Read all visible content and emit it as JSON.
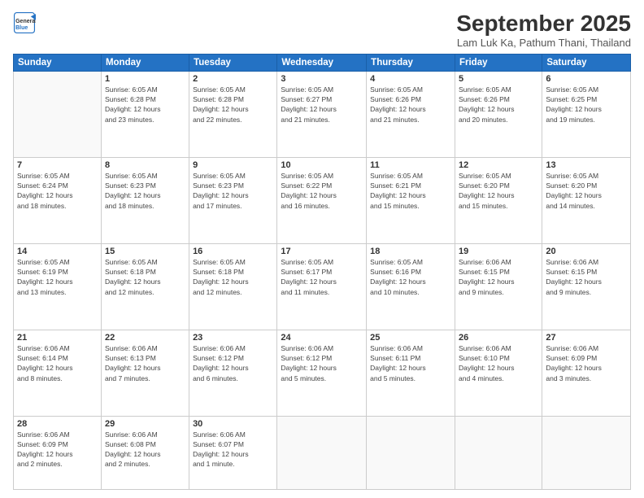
{
  "header": {
    "logo_line1": "General",
    "logo_line2": "Blue",
    "month": "September 2025",
    "location": "Lam Luk Ka, Pathum Thani, Thailand"
  },
  "weekdays": [
    "Sunday",
    "Monday",
    "Tuesday",
    "Wednesday",
    "Thursday",
    "Friday",
    "Saturday"
  ],
  "weeks": [
    [
      {
        "day": "",
        "info": ""
      },
      {
        "day": "1",
        "info": "Sunrise: 6:05 AM\nSunset: 6:28 PM\nDaylight: 12 hours\nand 23 minutes."
      },
      {
        "day": "2",
        "info": "Sunrise: 6:05 AM\nSunset: 6:28 PM\nDaylight: 12 hours\nand 22 minutes."
      },
      {
        "day": "3",
        "info": "Sunrise: 6:05 AM\nSunset: 6:27 PM\nDaylight: 12 hours\nand 21 minutes."
      },
      {
        "day": "4",
        "info": "Sunrise: 6:05 AM\nSunset: 6:26 PM\nDaylight: 12 hours\nand 21 minutes."
      },
      {
        "day": "5",
        "info": "Sunrise: 6:05 AM\nSunset: 6:26 PM\nDaylight: 12 hours\nand 20 minutes."
      },
      {
        "day": "6",
        "info": "Sunrise: 6:05 AM\nSunset: 6:25 PM\nDaylight: 12 hours\nand 19 minutes."
      }
    ],
    [
      {
        "day": "7",
        "info": "Sunrise: 6:05 AM\nSunset: 6:24 PM\nDaylight: 12 hours\nand 18 minutes."
      },
      {
        "day": "8",
        "info": "Sunrise: 6:05 AM\nSunset: 6:23 PM\nDaylight: 12 hours\nand 18 minutes."
      },
      {
        "day": "9",
        "info": "Sunrise: 6:05 AM\nSunset: 6:23 PM\nDaylight: 12 hours\nand 17 minutes."
      },
      {
        "day": "10",
        "info": "Sunrise: 6:05 AM\nSunset: 6:22 PM\nDaylight: 12 hours\nand 16 minutes."
      },
      {
        "day": "11",
        "info": "Sunrise: 6:05 AM\nSunset: 6:21 PM\nDaylight: 12 hours\nand 15 minutes."
      },
      {
        "day": "12",
        "info": "Sunrise: 6:05 AM\nSunset: 6:20 PM\nDaylight: 12 hours\nand 15 minutes."
      },
      {
        "day": "13",
        "info": "Sunrise: 6:05 AM\nSunset: 6:20 PM\nDaylight: 12 hours\nand 14 minutes."
      }
    ],
    [
      {
        "day": "14",
        "info": "Sunrise: 6:05 AM\nSunset: 6:19 PM\nDaylight: 12 hours\nand 13 minutes."
      },
      {
        "day": "15",
        "info": "Sunrise: 6:05 AM\nSunset: 6:18 PM\nDaylight: 12 hours\nand 12 minutes."
      },
      {
        "day": "16",
        "info": "Sunrise: 6:05 AM\nSunset: 6:18 PM\nDaylight: 12 hours\nand 12 minutes."
      },
      {
        "day": "17",
        "info": "Sunrise: 6:05 AM\nSunset: 6:17 PM\nDaylight: 12 hours\nand 11 minutes."
      },
      {
        "day": "18",
        "info": "Sunrise: 6:05 AM\nSunset: 6:16 PM\nDaylight: 12 hours\nand 10 minutes."
      },
      {
        "day": "19",
        "info": "Sunrise: 6:06 AM\nSunset: 6:15 PM\nDaylight: 12 hours\nand 9 minutes."
      },
      {
        "day": "20",
        "info": "Sunrise: 6:06 AM\nSunset: 6:15 PM\nDaylight: 12 hours\nand 9 minutes."
      }
    ],
    [
      {
        "day": "21",
        "info": "Sunrise: 6:06 AM\nSunset: 6:14 PM\nDaylight: 12 hours\nand 8 minutes."
      },
      {
        "day": "22",
        "info": "Sunrise: 6:06 AM\nSunset: 6:13 PM\nDaylight: 12 hours\nand 7 minutes."
      },
      {
        "day": "23",
        "info": "Sunrise: 6:06 AM\nSunset: 6:12 PM\nDaylight: 12 hours\nand 6 minutes."
      },
      {
        "day": "24",
        "info": "Sunrise: 6:06 AM\nSunset: 6:12 PM\nDaylight: 12 hours\nand 5 minutes."
      },
      {
        "day": "25",
        "info": "Sunrise: 6:06 AM\nSunset: 6:11 PM\nDaylight: 12 hours\nand 5 minutes."
      },
      {
        "day": "26",
        "info": "Sunrise: 6:06 AM\nSunset: 6:10 PM\nDaylight: 12 hours\nand 4 minutes."
      },
      {
        "day": "27",
        "info": "Sunrise: 6:06 AM\nSunset: 6:09 PM\nDaylight: 12 hours\nand 3 minutes."
      }
    ],
    [
      {
        "day": "28",
        "info": "Sunrise: 6:06 AM\nSunset: 6:09 PM\nDaylight: 12 hours\nand 2 minutes."
      },
      {
        "day": "29",
        "info": "Sunrise: 6:06 AM\nSunset: 6:08 PM\nDaylight: 12 hours\nand 2 minutes."
      },
      {
        "day": "30",
        "info": "Sunrise: 6:06 AM\nSunset: 6:07 PM\nDaylight: 12 hours\nand 1 minute."
      },
      {
        "day": "",
        "info": ""
      },
      {
        "day": "",
        "info": ""
      },
      {
        "day": "",
        "info": ""
      },
      {
        "day": "",
        "info": ""
      }
    ]
  ]
}
